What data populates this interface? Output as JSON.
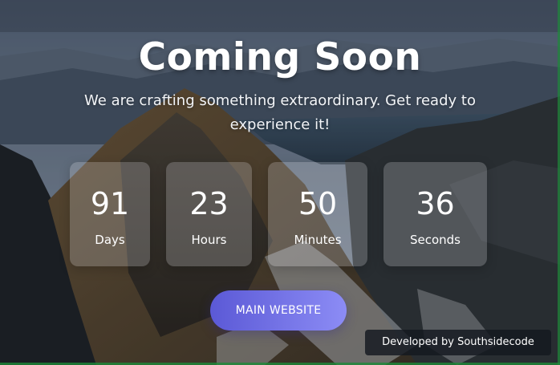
{
  "hero": {
    "title": "Coming Soon",
    "subtitle": "We are crafting something extraordinary. Get ready to experience it!"
  },
  "countdown": [
    {
      "value": "91",
      "unit": "Days"
    },
    {
      "value": "23",
      "unit": "Hours"
    },
    {
      "value": "50",
      "unit": "Minutes"
    },
    {
      "value": "36",
      "unit": "Seconds"
    }
  ],
  "actions": {
    "main_website_label": "MAIN WEBSITE"
  },
  "footer": {
    "credit": "Developed by Southsidecode"
  },
  "colors": {
    "button_gradient_start": "#5b59d6",
    "button_gradient_end": "#8c8cf5",
    "counter_tile": "rgba(230,232,238,0.22)",
    "text": "#ffffff"
  }
}
